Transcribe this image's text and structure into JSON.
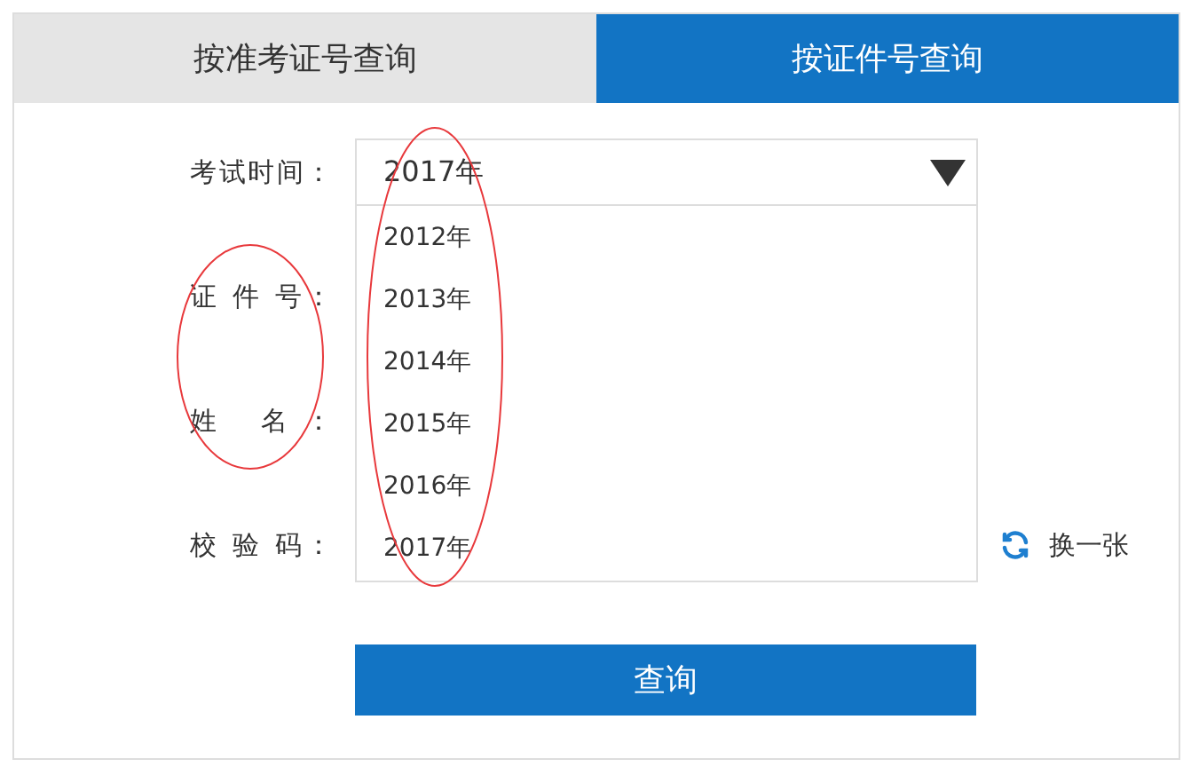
{
  "tabs": [
    {
      "label": "按准考证号查询",
      "selected": false
    },
    {
      "label": "按证件号查询",
      "selected": true
    }
  ],
  "form": {
    "rows": [
      {
        "kind": "select",
        "label": "考试时间：",
        "value": "2017年",
        "expanded": true,
        "options": [
          "2012年",
          "2013年",
          "2014年",
          "2015年",
          "2016年",
          "2017年"
        ]
      },
      {
        "kind": "text",
        "label": "证 件 号："
      },
      {
        "kind": "text",
        "label": "姓 名："
      },
      {
        "kind": "captcha",
        "label": "校 验 码：",
        "refresh_label": "换一张"
      }
    ],
    "submit": "查询"
  },
  "annotations": [
    {
      "kind": "ellipse",
      "color": "#e8393c"
    },
    {
      "kind": "ellipse",
      "color": "#e8393c"
    }
  ]
}
